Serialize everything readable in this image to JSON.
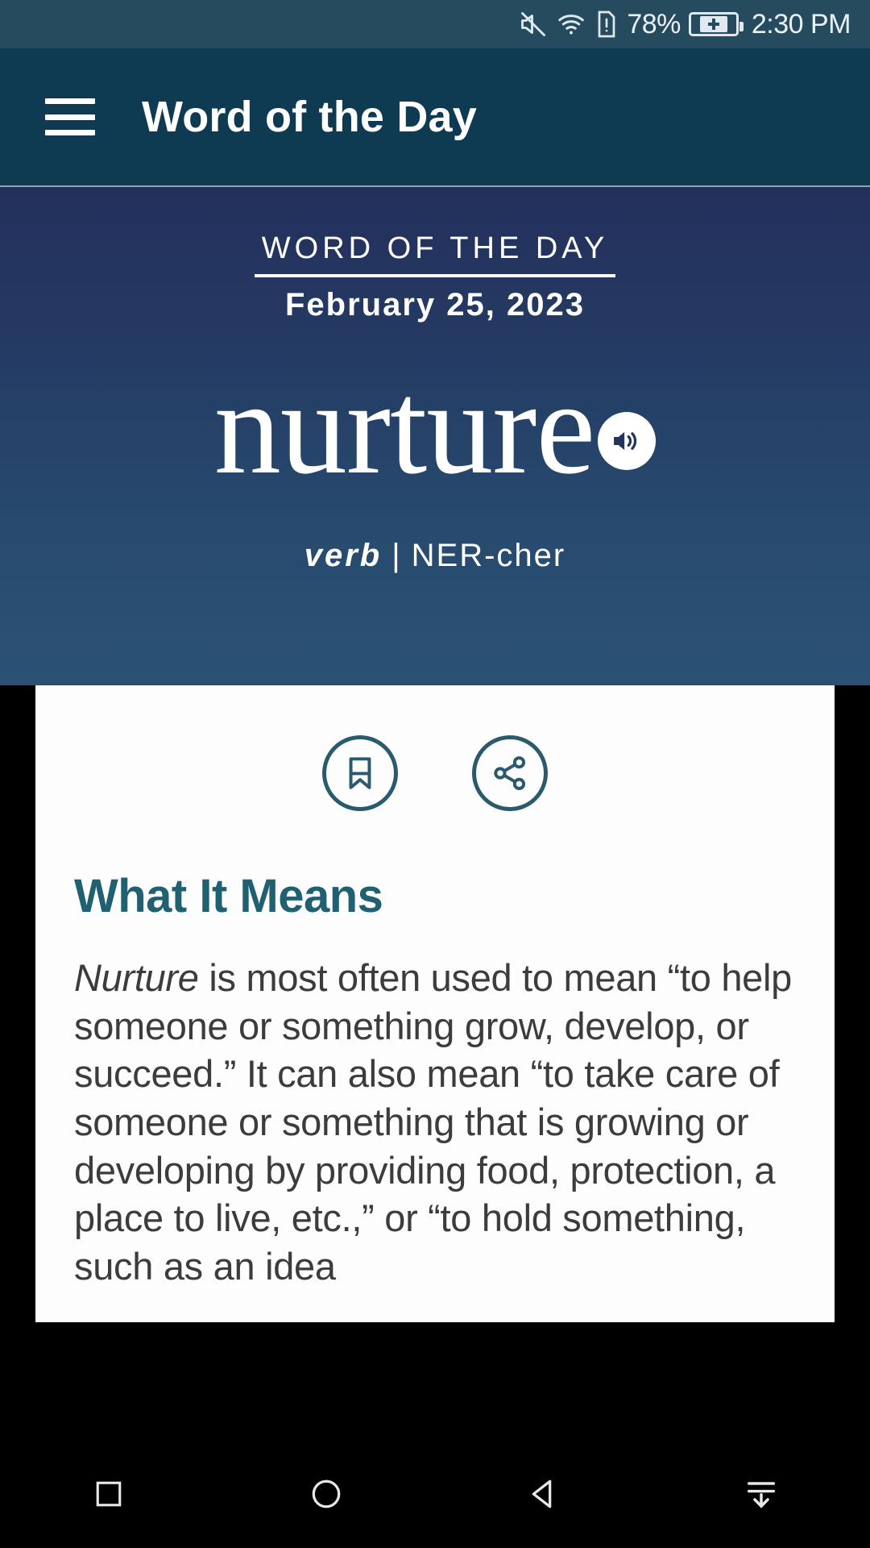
{
  "status_bar": {
    "icons": [
      "mute-icon",
      "wifi-icon",
      "sim-warning-icon",
      "battery-charging-icon"
    ],
    "battery_percent": "78%",
    "time": "2:30 PM"
  },
  "app_bar": {
    "menu_icon": "hamburger-menu-icon",
    "title": "Word of the Day"
  },
  "hero": {
    "label": "WORD OF THE DAY",
    "date": "February 25, 2023",
    "word": "nurture",
    "audio_icon": "speaker-icon",
    "part_of_speech": "verb",
    "separator": "|",
    "pronunciation": "NER-cher"
  },
  "card": {
    "actions": [
      {
        "name": "bookmark-button",
        "icon": "bookmark-icon"
      },
      {
        "name": "share-button",
        "icon": "share-icon"
      }
    ],
    "heading": "What It Means",
    "body_lead": "Nurture",
    "body_rest": " is most often used to mean “to help someone or something grow, develop, or succeed.” It can also mean “to take care of someone or something that is growing or developing by providing food, protection, a place to live, etc.,” or “to hold something, such as an idea"
  },
  "nav_bar": {
    "buttons": [
      {
        "name": "recents-button",
        "icon": "square-icon"
      },
      {
        "name": "home-button",
        "icon": "circle-icon"
      },
      {
        "name": "back-button",
        "icon": "triangle-back-icon"
      },
      {
        "name": "hide-keyboard-button",
        "icon": "down-arrow-lines-icon"
      }
    ]
  },
  "colors": {
    "app_bar": "#0e3b52",
    "status_bar": "#264a5e",
    "hero_top": "#23305c",
    "hero_bottom": "#2b5274",
    "accent_teal": "#1f6071",
    "card_bg": "#fdfdfd",
    "nav_bg": "#000000"
  }
}
